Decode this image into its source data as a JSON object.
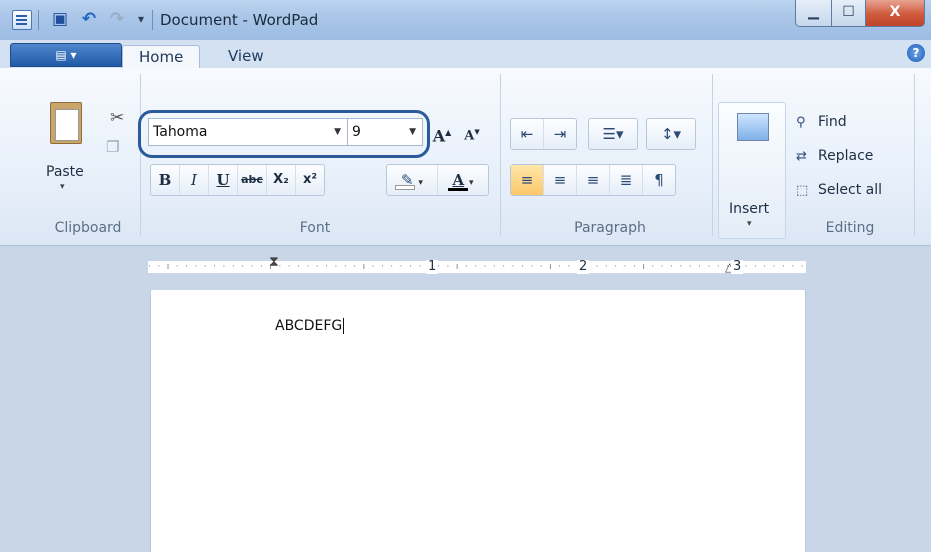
{
  "window": {
    "title": "Document - WordPad",
    "min_label": "▁",
    "max_label": "☐",
    "close_label": "X"
  },
  "qat": {
    "menu_glyph": "▾"
  },
  "ribbon": {
    "app_menu_label": "▤ ▾",
    "tabs": [
      {
        "label": "Home"
      },
      {
        "label": "View"
      }
    ],
    "help_label": "?",
    "clipboard": {
      "paste_label": "Paste",
      "group_label": "Clipboard"
    },
    "font": {
      "font_name": "Tahoma",
      "font_size": "9",
      "group_label": "Font",
      "bold": "B",
      "italic": "I",
      "underline": "U",
      "strike": "abc",
      "subscript": "X₂",
      "superscript": "x²",
      "grow": "A",
      "shrink": "A",
      "font_color_letter": "A"
    },
    "paragraph": {
      "group_label": "Paragraph"
    },
    "insert": {
      "label": "Insert"
    },
    "editing": {
      "group_label": "Editing",
      "find": "Find",
      "replace": "Replace",
      "select_all": "Select all"
    }
  },
  "ruler": {
    "labels": [
      "1",
      "2",
      "3"
    ]
  },
  "document": {
    "text": "ABCDEFG"
  }
}
